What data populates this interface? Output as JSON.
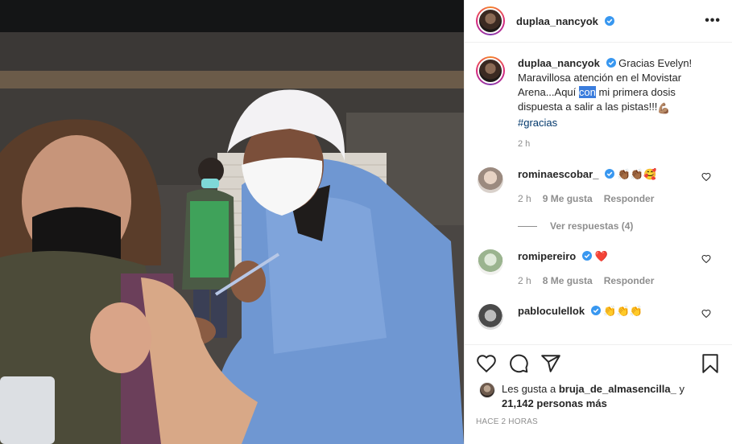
{
  "post": {
    "username": "duplaa_nancyok",
    "more_label": "•••"
  },
  "caption": {
    "username": "duplaa_nancyok",
    "text_before": "Gracias Evelyn! Maravillosa atención en el Movistar Arena...Aquí ",
    "highlighted": "con",
    "text_after": " mi primera dosis dispuesta a salir a las pistas!!!",
    "hashtag": "#gracias",
    "time": "2 h"
  },
  "comments": [
    {
      "username": "rominaescobar_",
      "emojis": "👏🏾👏🏾🥰",
      "time": "2 h",
      "likes": "9 Me gusta",
      "reply": "Responder",
      "view_replies": "Ver respuestas (4)"
    },
    {
      "username": "romipereiro",
      "emojis": "❤️",
      "time": "2 h",
      "likes": "8 Me gusta",
      "reply": "Responder"
    },
    {
      "username": "pabloculellok",
      "emojis": "👏👏👏"
    }
  ],
  "likes": {
    "prefix": "Les gusta a",
    "user": "bruja_de_almasencilla_",
    "joiner": "y",
    "count": "21,142 personas más"
  },
  "posted_ago": "HACE 2 HORAS",
  "colors": {
    "verified": "#3897f0",
    "highlight": "#3b7ddd",
    "heart": "#ed4956",
    "hashtag": "#00376b"
  },
  "icons": [
    "more-options-icon",
    "verified-badge-icon",
    "like-icon",
    "comment-icon",
    "share-icon",
    "save-icon"
  ]
}
